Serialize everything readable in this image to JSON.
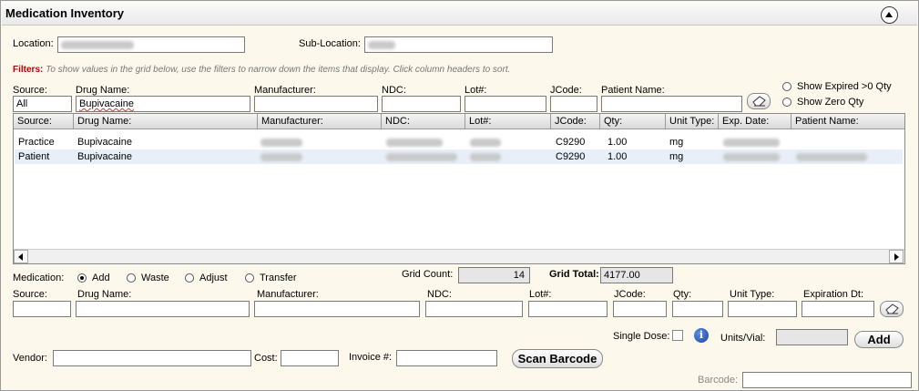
{
  "window": {
    "title": "Medication Inventory"
  },
  "location": {
    "label": "Location:",
    "sub_label": "Sub-Location:"
  },
  "filters": {
    "label": "Filters:",
    "hint": "To show values in the grid below, use the filters to narrow down the items that display. Click column headers to sort.",
    "source_label": "Source:",
    "source_value": "All",
    "drug_label": "Drug Name:",
    "drug_value": "Bupivacaine",
    "manufacturer_label": "Manufacturer:",
    "ndc_label": "NDC:",
    "lot_label": "Lot#:",
    "jcode_label": "JCode:",
    "patient_label": "Patient Name:",
    "show_expired": "Show Expired >0 Qty",
    "show_zero": "Show Zero Qty"
  },
  "grid": {
    "columns": [
      "Source:",
      "Drug Name:",
      "Manufacturer:",
      "NDC:",
      "Lot#:",
      "JCode:",
      "Qty:",
      "Unit Type:",
      "Exp. Date:",
      "Patient Name:"
    ],
    "rows": [
      {
        "source": "Practice",
        "drug": "Bupivacaine",
        "jcode": "C9290",
        "qty": "1.00",
        "unit": "mg"
      },
      {
        "source": "Patient",
        "drug": "Bupivacaine",
        "jcode": "C9290",
        "qty": "1.00",
        "unit": "mg"
      }
    ]
  },
  "medication": {
    "label": "Medication:",
    "options": [
      "Add",
      "Waste",
      "Adjust",
      "Transfer"
    ],
    "selected": "Add",
    "grid_count_label": "Grid Count:",
    "grid_count": "14",
    "grid_total_label": "Grid Total:",
    "grid_total": "4177.00"
  },
  "entry": {
    "source_label": "Source:",
    "drug_label": "Drug Name:",
    "manufacturer_label": "Manufacturer:",
    "ndc_label": "NDC:",
    "lot_label": "Lot#:",
    "jcode_label": "JCode:",
    "qty_label": "Qty:",
    "unit_label": "Unit Type:",
    "exp_label": "Expiration Dt:",
    "single_dose_label": "Single Dose:",
    "units_vial_label": "Units/Vial:",
    "add_label": "Add",
    "vendor_label": "Vendor:",
    "cost_label": "Cost:",
    "invoice_label": "Invoice #:",
    "scan_label": "Scan Barcode",
    "barcode_label": "Barcode:"
  }
}
